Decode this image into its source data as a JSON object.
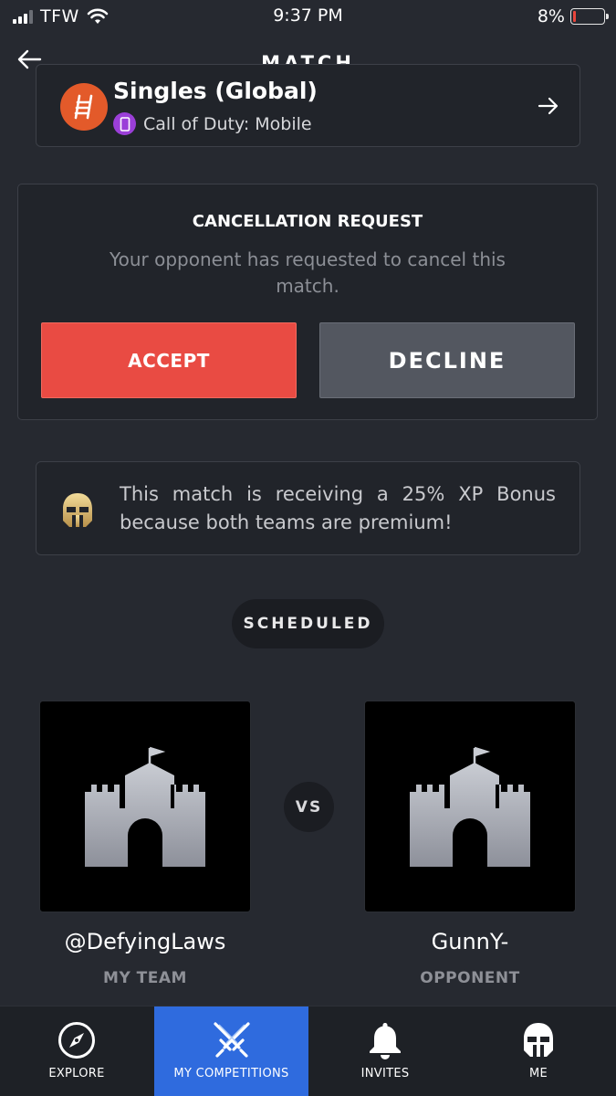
{
  "status_bar": {
    "carrier": "TFW",
    "time": "9:37 PM",
    "battery_percent": "8%",
    "battery_level": 0.08
  },
  "header": {
    "title": "MATCH",
    "back_icon": "arrow-left-icon"
  },
  "ladder": {
    "title": "Singles (Global)",
    "game": "Call of Duty: Mobile",
    "logo_color": "#e35a2a",
    "game_icon_color": "#9b3fd8"
  },
  "cancellation": {
    "title": "CANCELLATION REQUEST",
    "message": "Your opponent has requested to cancel this match.",
    "accept_label": "ACCEPT",
    "decline_label": "DECLINE",
    "accept_color": "#e94b43",
    "decline_color": "#535760"
  },
  "bonus": {
    "text": "This match is receiving a 25% XP Bonus because both teams are premium!"
  },
  "match": {
    "status": "SCHEDULED",
    "vs_label": "VS",
    "my_team": {
      "name": "@DefyingLaws",
      "role": "MY TEAM"
    },
    "opponent": {
      "name": "GunnY-",
      "role": "OPPONENT"
    }
  },
  "nav": {
    "items": [
      {
        "label": "EXPLORE",
        "icon": "compass-icon"
      },
      {
        "label": "MY COMPETITIONS",
        "icon": "crossed-swords-icon",
        "active": true
      },
      {
        "label": "INVITES",
        "icon": "bell-icon"
      },
      {
        "label": "ME",
        "icon": "helmet-icon"
      }
    ],
    "active_color": "#2f6bde"
  }
}
